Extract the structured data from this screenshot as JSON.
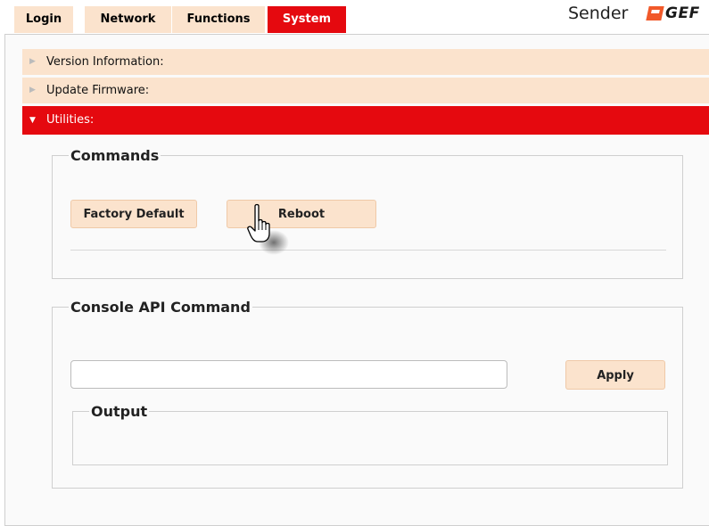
{
  "nav": {
    "tabs": [
      {
        "label": "Login"
      },
      {
        "label": "Network"
      },
      {
        "label": "Functions"
      },
      {
        "label": "System",
        "active": true
      }
    ],
    "brand": {
      "title": "Sender",
      "logo_text": "GEF"
    }
  },
  "accordion": {
    "version_label": "Version Information:",
    "firmware_label": "Update Firmware:",
    "utilities_label": "Utilities:"
  },
  "commands": {
    "legend": "Commands",
    "factory_label": "Factory Default",
    "reboot_label": "Reboot"
  },
  "console": {
    "legend": "Console API Command",
    "input_value": "",
    "apply_label": "Apply",
    "output_legend": "Output"
  },
  "colors": {
    "accent": "#e5090f",
    "tab_bg": "#fbe3cd",
    "brand_orange": "#f1592a"
  },
  "icons": {
    "caret": "caret-right-icon",
    "caret_open": "caret-down-icon",
    "cursor": "hand-pointer-icon"
  }
}
